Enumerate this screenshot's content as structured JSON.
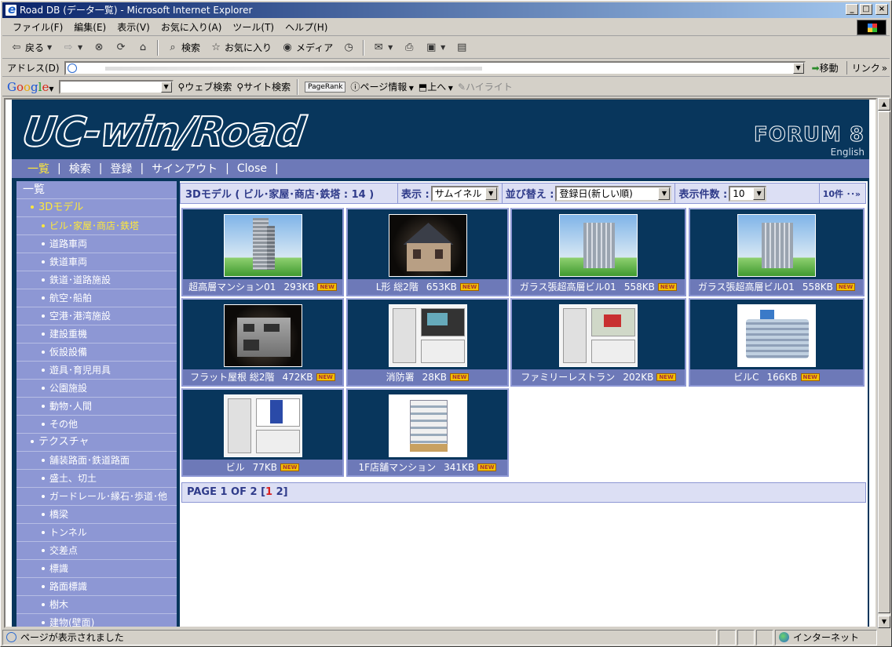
{
  "window": {
    "title": "Road DB (データ一覧) - Microsoft Internet Explorer",
    "buttons": {
      "minimize": "_",
      "maximize": "□",
      "close": "×"
    }
  },
  "menu": [
    "ファイル(F)",
    "編集(E)",
    "表示(V)",
    "お気に入り(A)",
    "ツール(T)",
    "ヘルプ(H)"
  ],
  "toolbar": {
    "back": "戻る",
    "search": "検索",
    "favorites": "お気に入り",
    "media": "メディア"
  },
  "address": {
    "label": "アドレス(D)",
    "go": "移動",
    "links": "リンク"
  },
  "google_bar": {
    "logo": [
      "G",
      "o",
      "o",
      "g",
      "l",
      "e"
    ],
    "web_search": "ウェブ検索",
    "site_search": "サイト検索",
    "pagerank": "PageRank",
    "page_info": "ページ情報",
    "up": "上へ",
    "highlight": "ハイライト"
  },
  "site": {
    "logo": "UC-win/Road",
    "brand": "FORUM 8",
    "english": "English",
    "nav": [
      {
        "label": "一覧",
        "active": true
      },
      {
        "label": "検索",
        "active": false
      },
      {
        "label": "登録",
        "active": false
      },
      {
        "label": "サインアウト",
        "active": false
      },
      {
        "label": "Close",
        "active": false
      }
    ],
    "sidebar": [
      {
        "label": "一覧",
        "level": 0,
        "active": false
      },
      {
        "label": "3Dモデル",
        "level": 1,
        "active": true
      },
      {
        "label": "ビル･家屋･商店･鉄塔",
        "level": 2,
        "active": true
      },
      {
        "label": "道路車両",
        "level": 2,
        "active": false
      },
      {
        "label": "鉄道車両",
        "level": 2,
        "active": false
      },
      {
        "label": "鉄道･道路施設",
        "level": 2,
        "active": false
      },
      {
        "label": "航空･船舶",
        "level": 2,
        "active": false
      },
      {
        "label": "空港･港湾施設",
        "level": 2,
        "active": false
      },
      {
        "label": "建設重機",
        "level": 2,
        "active": false
      },
      {
        "label": "仮設設備",
        "level": 2,
        "active": false
      },
      {
        "label": "遊具･育児用具",
        "level": 2,
        "active": false
      },
      {
        "label": "公園施設",
        "level": 2,
        "active": false
      },
      {
        "label": "動物･人間",
        "level": 2,
        "active": false
      },
      {
        "label": "その他",
        "level": 2,
        "active": false
      },
      {
        "label": "テクスチャ",
        "level": 1,
        "active": false
      },
      {
        "label": "舗装路面･鉄道路面",
        "level": 2,
        "active": false
      },
      {
        "label": "盛土、切土",
        "level": 2,
        "active": false
      },
      {
        "label": "ガードレール･縁石･歩道･他",
        "level": 2,
        "active": false
      },
      {
        "label": "橋梁",
        "level": 2,
        "active": false
      },
      {
        "label": "トンネル",
        "level": 2,
        "active": false
      },
      {
        "label": "交差点",
        "level": 2,
        "active": false
      },
      {
        "label": "標識",
        "level": 2,
        "active": false
      },
      {
        "label": "路面標識",
        "level": 2,
        "active": false
      },
      {
        "label": "樹木",
        "level": 2,
        "active": false
      },
      {
        "label": "建物(壁面)",
        "level": 2,
        "active": false
      }
    ],
    "filter": {
      "title": "3Dモデル ( ビル･家屋･商店･鉄塔 : 14 )",
      "display_label": "表示 :",
      "display_value": "サムイネル",
      "sort_label": "並び替え :",
      "sort_value": "登録日(新しい順)",
      "count_label": "表示件数 :",
      "count_value": "10",
      "more": "10件 ･･»"
    },
    "items": [
      {
        "name": "超高層マンション01",
        "size": "293KB",
        "new": "NEW",
        "thumb": "tower"
      },
      {
        "name": "L形 総2階",
        "size": "653KB",
        "new": "NEW",
        "thumb": "house"
      },
      {
        "name": "ガラス張超高層ビル01",
        "size": "558KB",
        "new": "NEW",
        "thumb": "glass"
      },
      {
        "name": "ガラス張超高層ビル01",
        "size": "558KB",
        "new": "NEW",
        "thumb": "glass"
      },
      {
        "name": "フラット屋根 総2階",
        "size": "472KB",
        "new": "NEW",
        "thumb": "flat"
      },
      {
        "name": "消防署",
        "size": "28KB",
        "new": "NEW",
        "thumb": "ui"
      },
      {
        "name": "ファミリーレストラン",
        "size": "202KB",
        "new": "NEW",
        "thumb": "ui2"
      },
      {
        "name": "ビルC",
        "size": "166KB",
        "new": "NEW",
        "thumb": "office"
      },
      {
        "name": "ビル",
        "size": "77KB",
        "new": "NEW",
        "thumb": "ui3"
      },
      {
        "name": "1F店舗マンション",
        "size": "341KB",
        "new": "NEW",
        "thumb": "mansion"
      }
    ],
    "pager": {
      "text": "PAGE 1 OF 2 [",
      "p1": "1",
      "p2": "2",
      "close": "]"
    }
  },
  "status": {
    "text": "ページが表示されました",
    "zone": "インターネット"
  }
}
